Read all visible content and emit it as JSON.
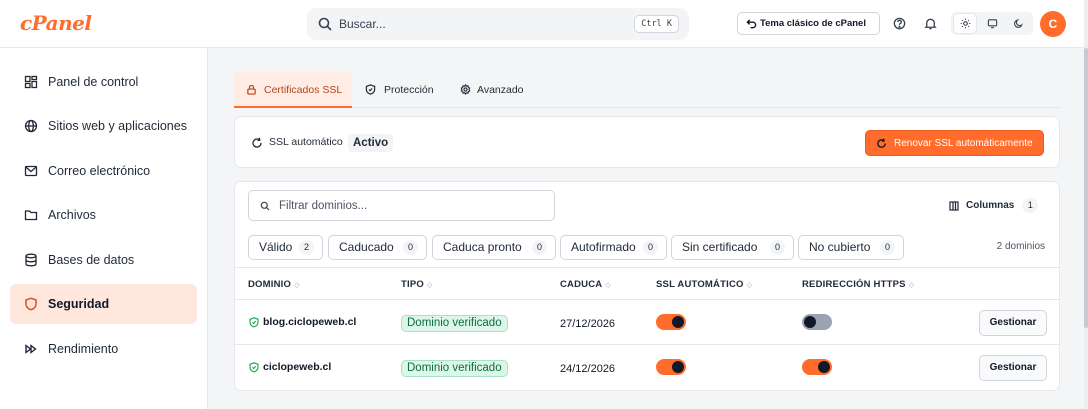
{
  "header": {
    "logo": "cPanel",
    "search_placeholder": "Buscar...",
    "search_shortcut": "Ctrl K",
    "theme_button": "Tema clásico de cPanel",
    "avatar_initial": "C",
    "accent": "#ff6c2c"
  },
  "sidebar": {
    "items": [
      {
        "label": "Panel de control",
        "icon": "dashboard-icon"
      },
      {
        "label": "Sitios web y aplicaciones",
        "icon": "globe-icon"
      },
      {
        "label": "Correo electrónico",
        "icon": "mail-icon"
      },
      {
        "label": "Archivos",
        "icon": "folder-icon"
      },
      {
        "label": "Bases de datos",
        "icon": "database-icon"
      },
      {
        "label": "Seguridad",
        "icon": "shield-icon",
        "active": true
      },
      {
        "label": "Rendimiento",
        "icon": "fast-forward-icon"
      }
    ]
  },
  "tabs": [
    {
      "label": "Certificados SSL",
      "icon": "lock-icon",
      "active": true
    },
    {
      "label": "Protección",
      "icon": "shield-icon"
    },
    {
      "label": "Avanzado",
      "icon": "gear-icon"
    }
  ],
  "ssl": {
    "label": "SSL automático",
    "status": "Activo",
    "renew_button": "Renovar SSL automáticamente"
  },
  "table": {
    "filter_placeholder": "Filtrar dominios...",
    "columns_button": "Columnas",
    "columns_count": "1",
    "domain_count": "2 dominios",
    "filters": [
      {
        "label": "Válido",
        "count": "2"
      },
      {
        "label": "Caducado",
        "count": "0"
      },
      {
        "label": "Caduca pronto",
        "count": "0"
      },
      {
        "label": "Autofirmado",
        "count": "0"
      },
      {
        "label": "Sin certificado",
        "count": "0"
      },
      {
        "label": "No cubierto",
        "count": "0"
      }
    ],
    "headers": {
      "domain": "DOMINIO",
      "type": "TIPO",
      "expires": "CADUCA",
      "auto_ssl": "SSL AUTOMÁTICO",
      "https_redirect": "REDIRECCIÓN HTTPS"
    },
    "rows": [
      {
        "domain": "blog.ciclopeweb.cl",
        "type": "Dominio verificado",
        "expires": "27/12/2026",
        "auto_ssl": true,
        "https_redirect": false,
        "action": "Gestionar"
      },
      {
        "domain": "ciclopeweb.cl",
        "type": "Dominio verificado",
        "expires": "24/12/2026",
        "auto_ssl": true,
        "https_redirect": true,
        "action": "Gestionar"
      }
    ]
  }
}
